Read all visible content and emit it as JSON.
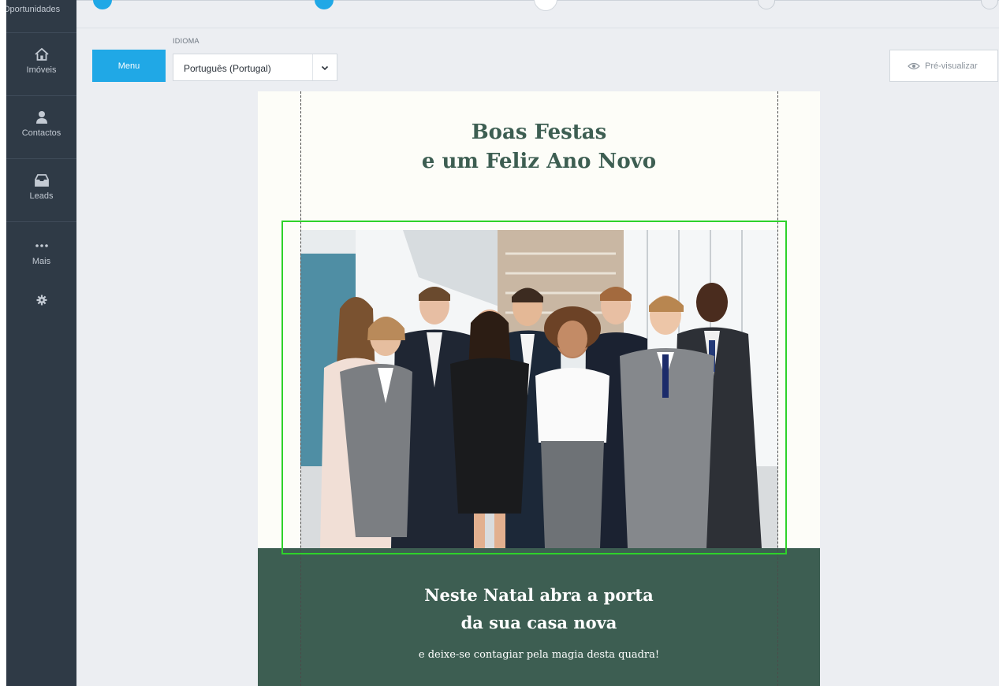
{
  "sidebar": {
    "top_item": "Oportunidades",
    "items": [
      {
        "label": "Imóveis",
        "icon": "home-icon"
      },
      {
        "label": "Contactos",
        "icon": "person-icon"
      },
      {
        "label": "Leads",
        "icon": "inbox-icon"
      },
      {
        "label": "Mais",
        "icon": "more-icon"
      }
    ],
    "settings_icon": "gear-icon"
  },
  "toolbar": {
    "menu_label": "Menu",
    "language_label": "IDIOMA",
    "language_value": "Português (Portugal)",
    "preview_label": "Pré-visualizar"
  },
  "email": {
    "title_line1": "Boas Festas",
    "title_line2": "e um Feliz Ano Novo",
    "image_alt": "team-photo",
    "headline_line1": "Neste Natal abra a porta",
    "headline_line2": "da sua casa nova",
    "subtext": "e deixe-se contagiar pela magia desta quadra!"
  },
  "colors": {
    "sidebar_bg": "#2f3a46",
    "accent_blue": "#20a8e6",
    "email_green": "#3d5e52",
    "title_green": "#3d5e52",
    "selection_green": "#2ed22a",
    "canvas_bg": "#eceef2"
  }
}
